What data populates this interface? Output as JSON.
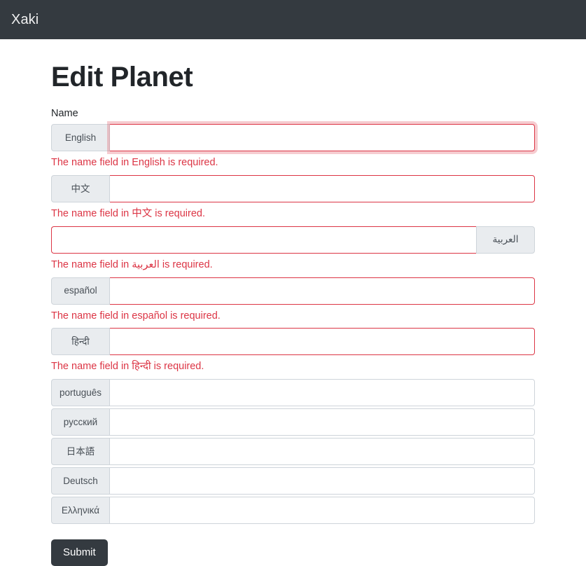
{
  "navbar": {
    "brand": "Xaki"
  },
  "page": {
    "title": "Edit Planet"
  },
  "form": {
    "field_label": "Name",
    "submit_label": "Submit",
    "rows": [
      {
        "language": "English",
        "value": "",
        "direction": "ltr",
        "invalid": true,
        "focused": true,
        "error": "The name field in English is required."
      },
      {
        "language": "中文",
        "value": "",
        "direction": "ltr",
        "invalid": true,
        "focused": false,
        "error": "The name field in 中文 is required."
      },
      {
        "language": "العربية",
        "value": "",
        "direction": "rtl",
        "invalid": true,
        "focused": false,
        "error": "The name field in العربية is required."
      },
      {
        "language": "español",
        "value": "",
        "direction": "ltr",
        "invalid": true,
        "focused": false,
        "error": "The name field in español is required."
      },
      {
        "language": "हिन्दी",
        "value": "",
        "direction": "ltr",
        "invalid": true,
        "focused": false,
        "error": "The name field in हिन्दी is required."
      },
      {
        "language": "português",
        "value": "",
        "direction": "ltr",
        "invalid": false,
        "focused": false,
        "error": ""
      },
      {
        "language": "русский",
        "value": "",
        "direction": "ltr",
        "invalid": false,
        "focused": false,
        "error": ""
      },
      {
        "language": "日本語",
        "value": "",
        "direction": "ltr",
        "invalid": false,
        "focused": false,
        "error": ""
      },
      {
        "language": "Deutsch",
        "value": "",
        "direction": "ltr",
        "invalid": false,
        "focused": false,
        "error": ""
      },
      {
        "language": "Ελληνικά",
        "value": "",
        "direction": "ltr",
        "invalid": false,
        "focused": false,
        "error": ""
      }
    ]
  },
  "colors": {
    "navbar_bg": "#343a40",
    "error": "#dc3545",
    "addon_bg": "#e9ecef",
    "border": "#ced4da",
    "button_bg": "#343a40"
  }
}
